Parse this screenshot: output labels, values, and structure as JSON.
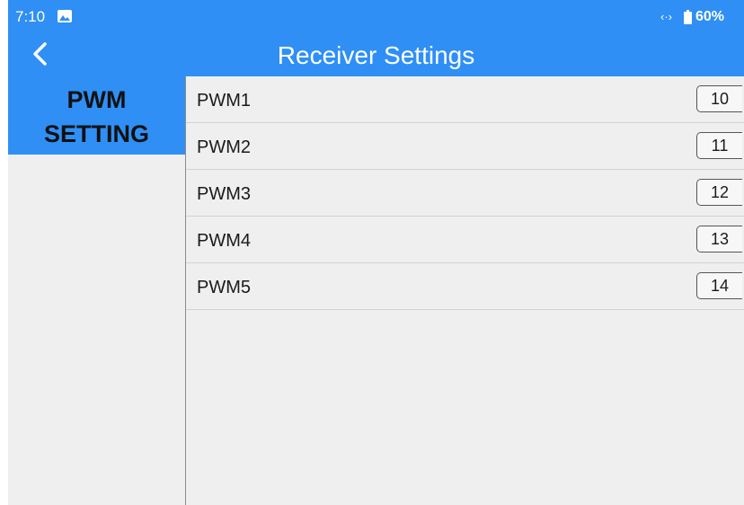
{
  "status_bar": {
    "time": "7:10",
    "battery": "60%",
    "signal_glyph": "‹·›",
    "icons": [
      "gallery-icon",
      "signal-arrows-icon",
      "battery-icon"
    ]
  },
  "header": {
    "title": "Receiver Settings",
    "back_icon": "chevron-left-icon"
  },
  "sidebar": {
    "items": [
      {
        "line1": "PWM",
        "line2": "SETTING",
        "active": true
      }
    ]
  },
  "pwm_list": [
    {
      "label": "PWM1",
      "value": "10"
    },
    {
      "label": "PWM2",
      "value": "11"
    },
    {
      "label": "PWM3",
      "value": "12"
    },
    {
      "label": "PWM4",
      "value": "13"
    },
    {
      "label": "PWM5",
      "value": "14"
    }
  ],
  "colors": {
    "accent": "#2f8ff5",
    "background": "#efefef",
    "divider": "#d2d2d2"
  }
}
